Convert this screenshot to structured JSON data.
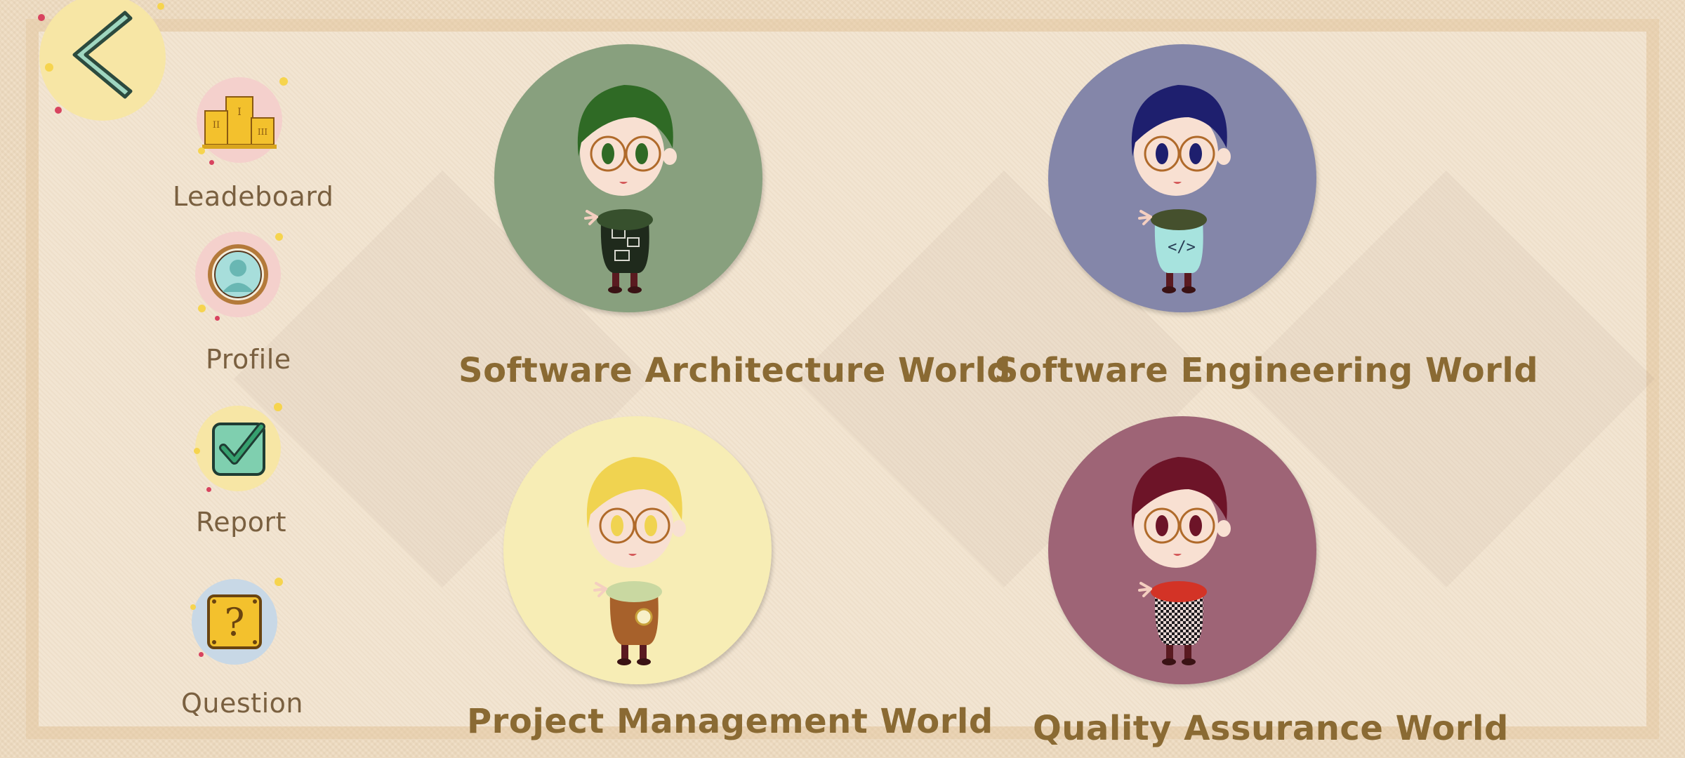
{
  "colors": {
    "label": "#8a6a33",
    "sidebar_label": "#7a6040",
    "back_button_bg": "#f7e6a5"
  },
  "nav": {
    "back_icon": "chevron-left-icon"
  },
  "sidebar": {
    "items": [
      {
        "label": "Leadeboard",
        "icon": "podium-icon"
      },
      {
        "label": "Profile",
        "icon": "user-icon"
      },
      {
        "label": "Report",
        "icon": "checkbox-icon"
      },
      {
        "label": "Question",
        "icon": "question-block-icon"
      }
    ]
  },
  "worlds": [
    {
      "label": "Software Architecture World",
      "color": "#88a07e",
      "hair": "#2f6a25",
      "outfit": "#1f2a1c",
      "scarf": "#37502d"
    },
    {
      "label": "Software Engineering World",
      "color": "#8486a9",
      "hair": "#1e1f6e",
      "outfit": "#a7e3de",
      "scarf": "#45502d"
    },
    {
      "label": "Project Management World",
      "color": "#f7edb5",
      "hair": "#f0d350",
      "outfit": "#a7612b",
      "scarf": "#c9d8a1"
    },
    {
      "label": "Quality Assurance World",
      "color": "#9e6476",
      "hair": "#6d1428",
      "outfit": "#1e1a1e",
      "scarf": "#d33326"
    }
  ]
}
